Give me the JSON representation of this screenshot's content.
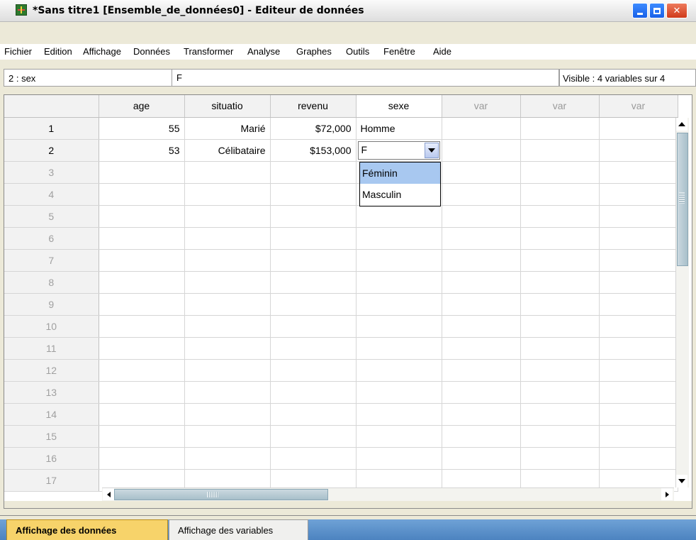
{
  "window": {
    "title": "*Sans titre1 [Ensemble_de_données0] - Editeur de données",
    "icon": "spss-grid-icon"
  },
  "menu": {
    "items": [
      "Fichier",
      "Edition",
      "Affichage",
      "Données",
      "Transformer",
      "Analyse",
      "Graphes",
      "Outils",
      "Fenêtre",
      "Aide"
    ]
  },
  "cellbar": {
    "ref": "2 : sex",
    "value": "F",
    "visible": "Visible : 4 variables sur 4"
  },
  "grid": {
    "columns": [
      "age",
      "situatio",
      "revenu",
      "sexe",
      "var",
      "var",
      "var"
    ],
    "rows": [
      {
        "num": "1",
        "age": "55",
        "situatio": "Marié",
        "revenu": "$72,000",
        "sexe": "Homme"
      },
      {
        "num": "2",
        "age": "53",
        "situatio": "Célibataire",
        "revenu": "$153,000",
        "sexe": "F"
      }
    ],
    "empty_rows": [
      "3",
      "4",
      "5",
      "6",
      "7",
      "8",
      "9",
      "10",
      "11",
      "12",
      "13",
      "14",
      "15",
      "16",
      "17"
    ]
  },
  "dropdown": {
    "options": [
      "Féminin",
      "Masculin"
    ],
    "highlighted": "Féminin"
  },
  "tabs": {
    "active": "Affichage des données",
    "inactive": "Affichage des variables"
  },
  "colors": {
    "active_tab": "#f7d36a",
    "tab_strip": "#5b8fcb",
    "dropdown_highlight": "#a8c8f0"
  }
}
